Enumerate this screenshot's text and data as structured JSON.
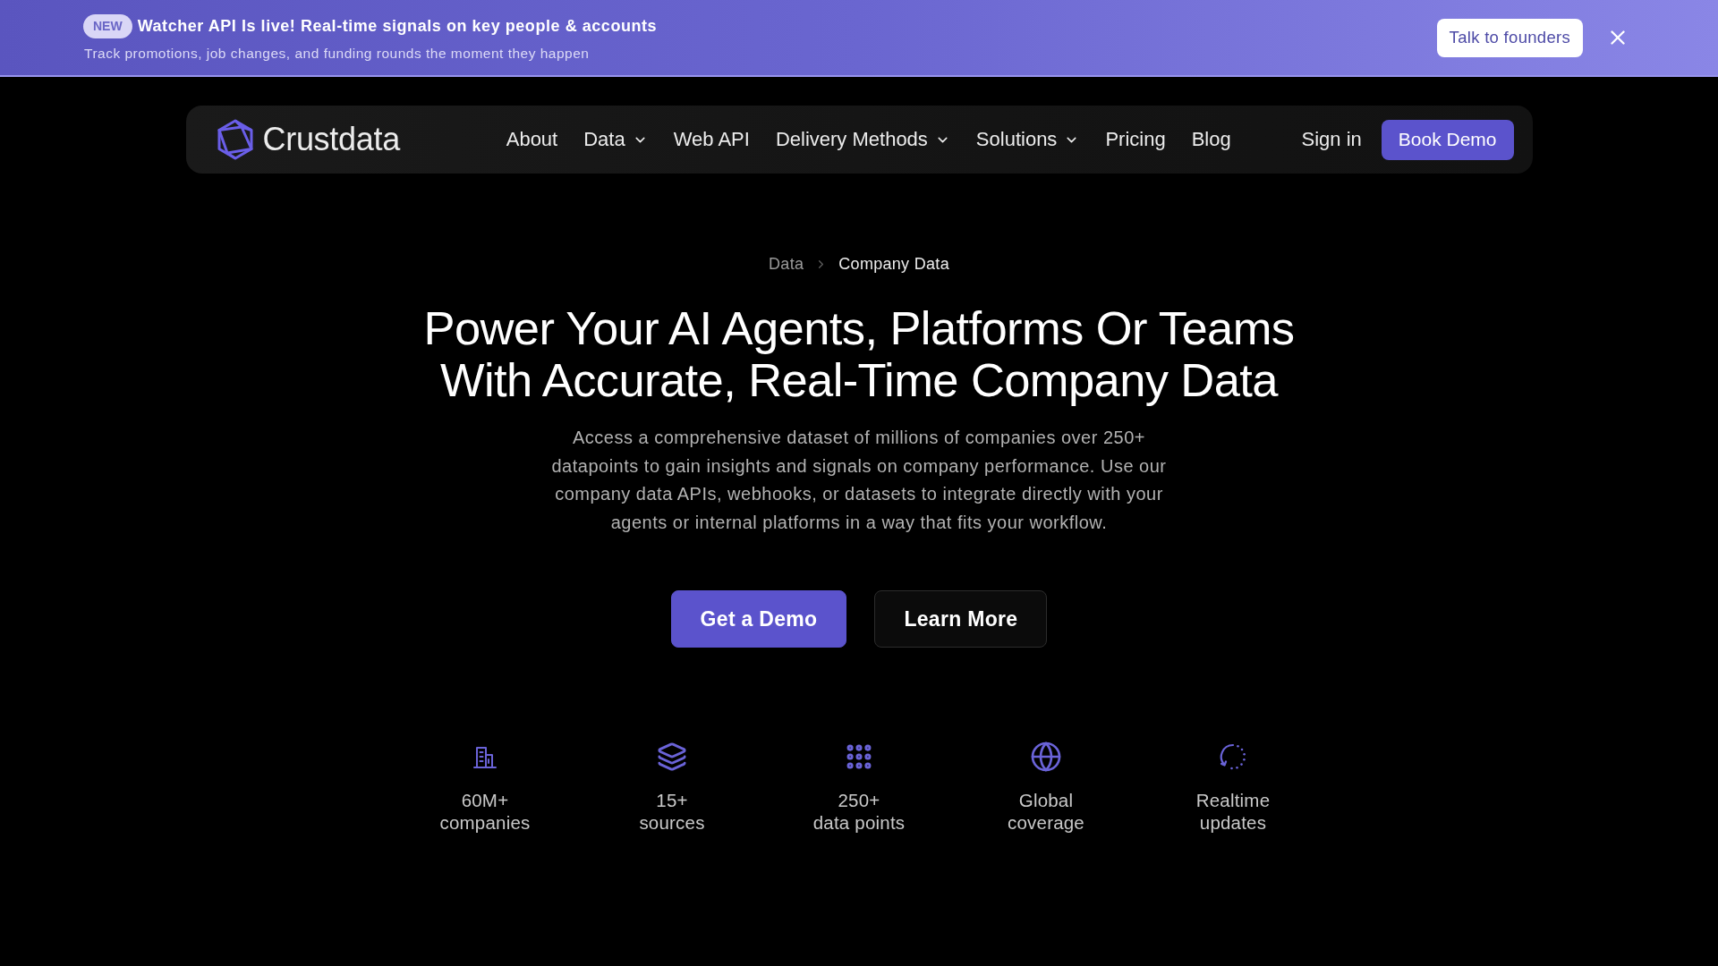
{
  "announcement": {
    "badge": "NEW",
    "title": "Watcher API Is live! Real-time signals on key people & accounts",
    "subtitle": "Track promotions, job changes, and funding rounds the moment they happen",
    "button": "Talk to founders"
  },
  "navbar": {
    "logo": "Crustdata",
    "items": [
      {
        "label": "About",
        "dropdown": false
      },
      {
        "label": "Data",
        "dropdown": true
      },
      {
        "label": "Web API",
        "dropdown": false
      },
      {
        "label": "Delivery Methods",
        "dropdown": true
      },
      {
        "label": "Solutions",
        "dropdown": true
      },
      {
        "label": "Pricing",
        "dropdown": false
      },
      {
        "label": "Blog",
        "dropdown": false
      }
    ],
    "sign_in": "Sign in",
    "cta": "Book Demo"
  },
  "breadcrumb": [
    {
      "label": "Data",
      "current": false
    },
    {
      "label": "Company Data",
      "current": true
    }
  ],
  "hero": {
    "title_lines": [
      "Power Your AI Agents, Platforms Or Teams",
      "With Accurate, Real-Time Company Data"
    ],
    "description": "Access a comprehensive dataset of millions of companies over 250+ datapoints to gain insights and signals on company performance. Use our company data APIs, webhooks, or datasets to integrate directly with your agents or internal platforms in a way that fits your workflow.",
    "buttons": [
      {
        "label": "Get a Demo",
        "kind": "primary"
      },
      {
        "label": "Learn More",
        "kind": "secondary"
      }
    ]
  },
  "stats": [
    {
      "value": "60M+",
      "label": "companies"
    },
    {
      "value": "15+",
      "label": "sources"
    },
    {
      "value": "250+",
      "label": "data points"
    },
    {
      "value": "Global",
      "label": "coverage"
    },
    {
      "value": "Realtime",
      "label": "updates"
    }
  ]
}
